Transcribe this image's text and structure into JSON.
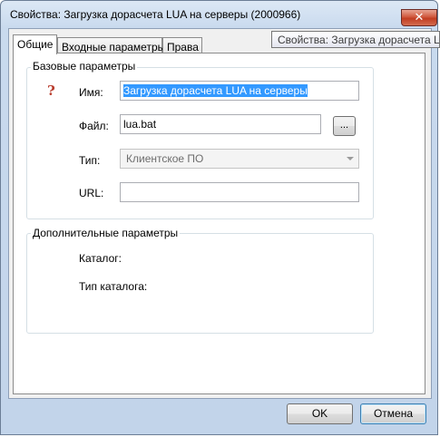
{
  "window": {
    "title": "Свойства: Загрузка дорасчета LUA на серверы (2000966)",
    "close_symbol": "✕"
  },
  "tooltip": {
    "text": "Свойства: Загрузка дорасчета LUA на серверы (2000966)"
  },
  "tabs": [
    {
      "label": "Общие",
      "active": true
    },
    {
      "label": "Входные параметры",
      "active": false
    },
    {
      "label": "Права",
      "active": false
    }
  ],
  "basic_group": {
    "title": "Базовые параметры",
    "name_label": "Имя:",
    "name_value": "Загрузка дорасчета LUA на серверы",
    "file_label": "Файл:",
    "file_value": "lua.bat",
    "browse_label": "...",
    "type_label": "Тип:",
    "type_value": "Клиентское ПО",
    "url_label": "URL:",
    "url_value": ""
  },
  "extra_group": {
    "title": "Дополнительные параметры",
    "catalog_label": "Каталог:",
    "catalog_type_label": "Тип каталога:"
  },
  "buttons": {
    "ok": "OK",
    "cancel": "Отмена"
  },
  "icons": {
    "help": "help-icon",
    "close": "close-icon",
    "dropdown": "chevron-down-icon"
  },
  "colors": {
    "selection": "#3399ff",
    "help_icon": "#b83b2c",
    "close_button": "#c8452a"
  }
}
